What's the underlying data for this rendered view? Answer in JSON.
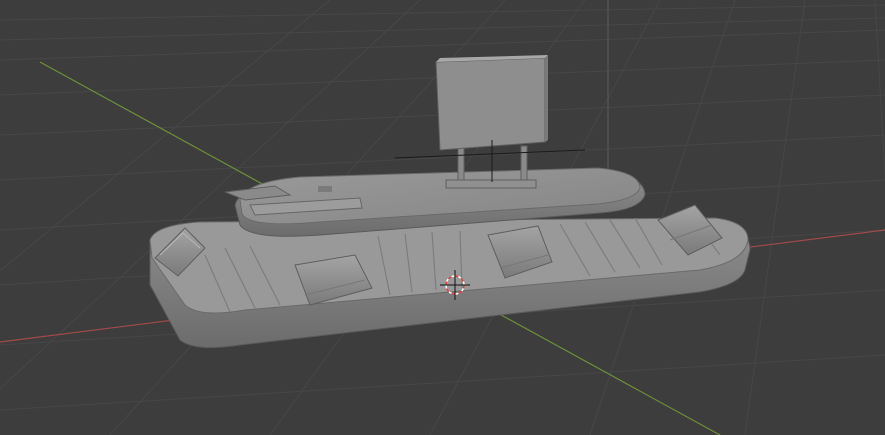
{
  "viewport": {
    "background": "#3d3d3d",
    "grid_color": "#4a4a4a",
    "x_axis_color": "#a34a4a",
    "y_axis_color": "#6e8f3a",
    "z_axis_color": "#5f5f5f"
  },
  "model": {
    "base_color": "#8a8a8a",
    "top_color": "#959595",
    "shadow_color": "#6a6a6a",
    "edge_color": "#5a5a5a",
    "luggage_count": 4
  },
  "icons": {
    "origin": "object-origin-icon",
    "cursor": "3d-cursor-icon"
  }
}
